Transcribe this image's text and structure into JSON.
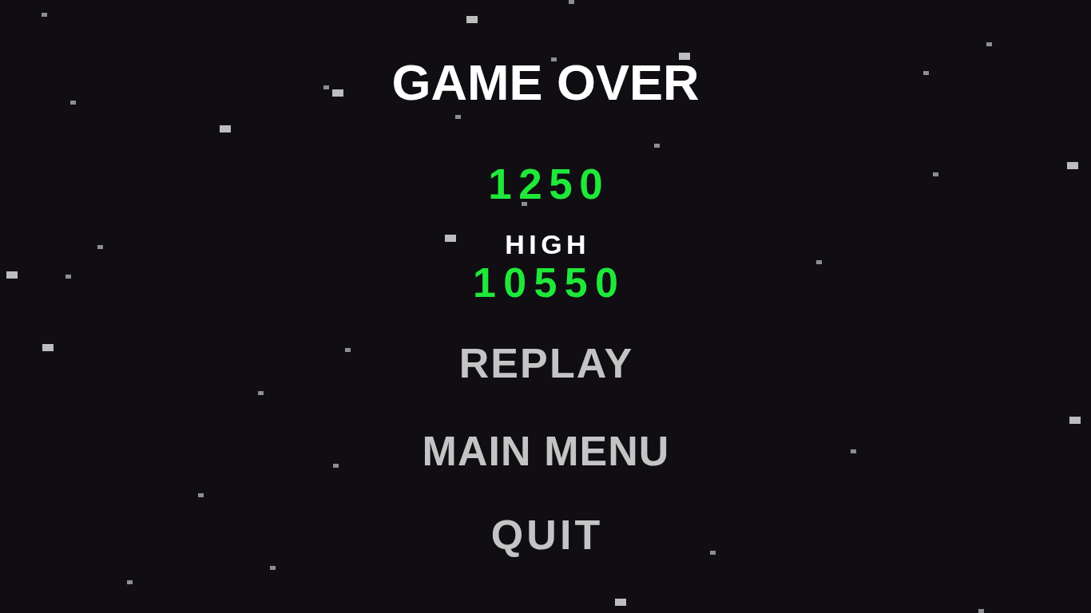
{
  "title": "GAME OVER",
  "score": "1250",
  "high_score": {
    "label": "HIGH",
    "value": "10550"
  },
  "menu": [
    {
      "label": "REPLAY"
    },
    {
      "label": "MAIN MENU"
    },
    {
      "label": "QUIT"
    }
  ]
}
